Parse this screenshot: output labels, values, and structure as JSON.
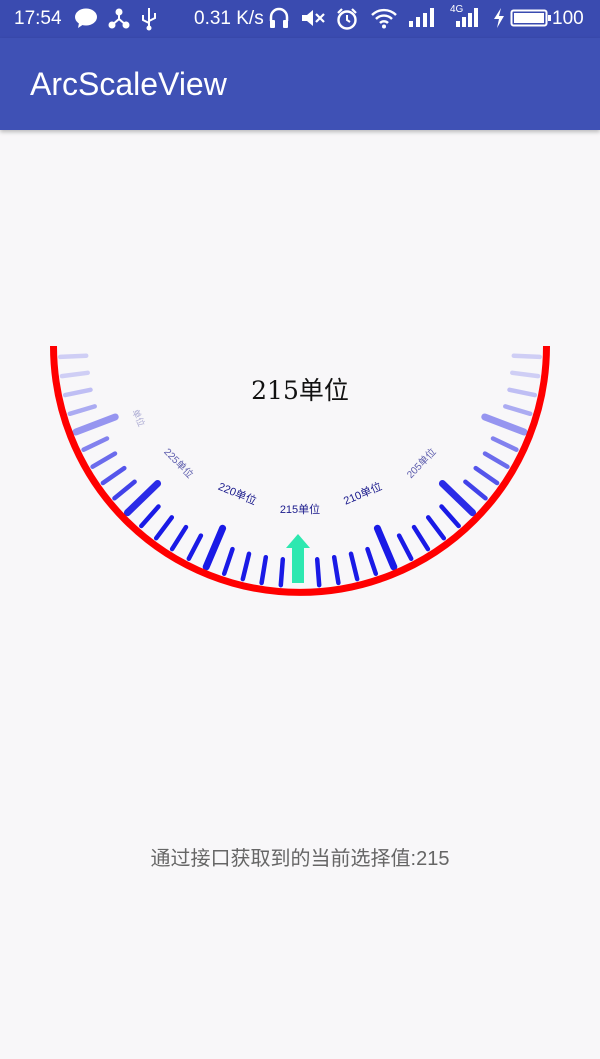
{
  "status_bar": {
    "time": "17:54",
    "network_speed": "0.31 K/s",
    "network_type": "4G",
    "battery": "100"
  },
  "app_bar": {
    "title": "ArcScaleView"
  },
  "scale": {
    "current_value_label": "215单位",
    "unit": "单位",
    "visible_labels": [
      "205单位",
      "210单位",
      "215单位",
      "220单位",
      "225单位",
      "单位"
    ],
    "selected_value": 215,
    "colors": {
      "rim": "#ff0000",
      "tick": "#1a1ae6",
      "pointer": "#2ee8b0",
      "label": "#1a1a8c"
    }
  },
  "result": {
    "text": "通过接口获取到的当前选择值:215"
  }
}
